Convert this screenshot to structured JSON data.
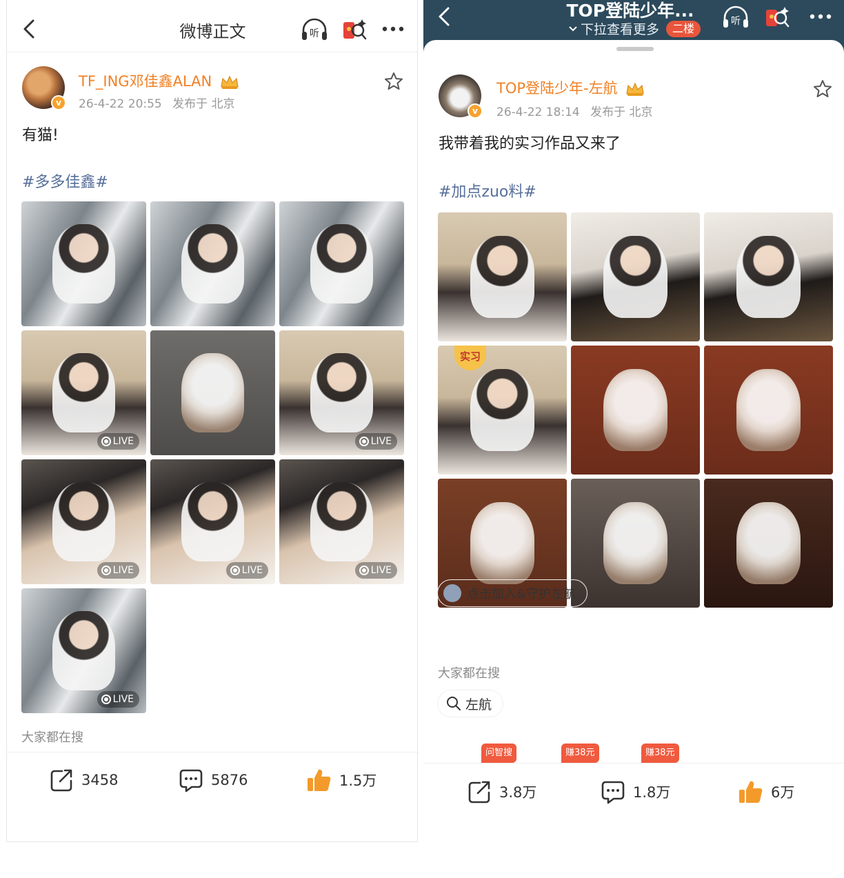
{
  "left": {
    "nav": {
      "title": "微博正文",
      "listen_label": "听"
    },
    "post": {
      "username": "TF_ING邓佳鑫ALAN",
      "time": "26-4-22 20:55",
      "location": "发布于 北京",
      "text": "有猫!",
      "topic": "#多多佳鑫#",
      "images": [
        {
          "subject": "boy-in-elevator",
          "live": false
        },
        {
          "subject": "boy-in-elevator",
          "live": false
        },
        {
          "subject": "boy-in-elevator",
          "live": false
        },
        {
          "subject": "boy-selfie",
          "live": true
        },
        {
          "subject": "white-cat",
          "live": false
        },
        {
          "subject": "boy-selfie",
          "live": true
        },
        {
          "subject": "boy-lying-on-arm",
          "live": true
        },
        {
          "subject": "boy-lying-on-arm",
          "live": true
        },
        {
          "subject": "boy-lying-on-arm",
          "live": true
        },
        {
          "subject": "boy-in-elevator",
          "live": true
        }
      ],
      "live_label": "LIVE"
    },
    "section_everyone_searching": "大家都在搜",
    "actions": {
      "share": "3458",
      "comment": "5876",
      "like": "1.5万"
    }
  },
  "right": {
    "header": {
      "title": "TOP登陆少年...",
      "subtitle": "下拉查看更多",
      "floor_badge": "二楼",
      "listen_label": "听"
    },
    "post": {
      "username": "TOP登陆少年-左航",
      "time": "26-4-22 18:14",
      "location": "发布于 北京",
      "text": "我带着我的实习作品又来了",
      "topic": "#加点zuo料#",
      "images": [
        {
          "subject": "boy-selfie"
        },
        {
          "subject": "boy-mirror-selfie"
        },
        {
          "subject": "boy-mirror-selfie"
        },
        {
          "subject": "boy-selfie",
          "sticker": "实习"
        },
        {
          "subject": "ragdoll-cat"
        },
        {
          "subject": "ragdoll-cat"
        },
        {
          "subject": "ragdoll-cat-face"
        },
        {
          "subject": "ragdoll-cat-held"
        },
        {
          "subject": "ragdoll-cat-lying"
        }
      ]
    },
    "join_chip": "点击加入&守护左航",
    "section_everyone_searching": "大家都在搜",
    "search_chip": "左航",
    "peek_badges": [
      "问智搜",
      "赚38元",
      "赚38元"
    ],
    "actions": {
      "share": "3.8万",
      "comment": "1.8万",
      "like": "6万"
    }
  },
  "colors": {
    "username": "#f08024",
    "topic": "#566f9a",
    "header_bg": "#2c4a5c",
    "like": "#f39a2b"
  }
}
